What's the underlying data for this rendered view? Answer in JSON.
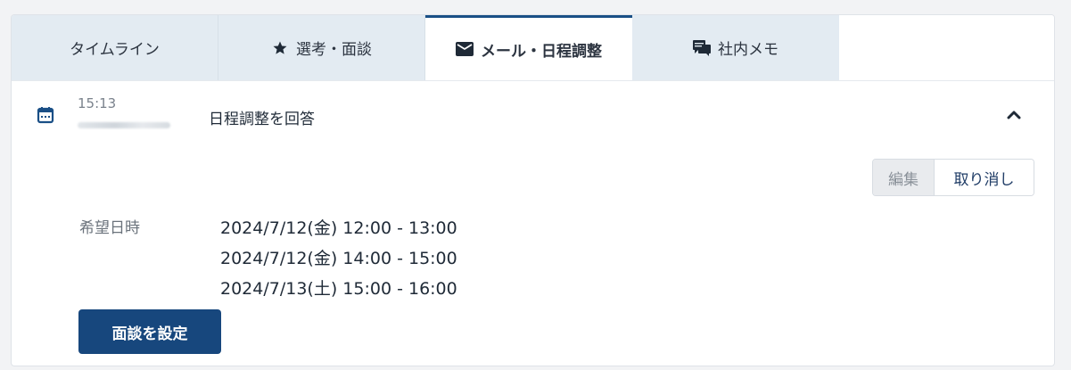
{
  "tabs": [
    {
      "label": "タイムライン",
      "icon": "",
      "active": false
    },
    {
      "label": "選考・面談",
      "icon": "star-icon",
      "active": false
    },
    {
      "label": "メール・日程調整",
      "icon": "mail-icon",
      "active": true
    },
    {
      "label": "社内メモ",
      "icon": "chat-icon",
      "active": false
    }
  ],
  "entry": {
    "time": "15:13",
    "title": "日程調整を回答"
  },
  "actions": {
    "edit_label": "編集",
    "cancel_label": "取り消し"
  },
  "details": {
    "preferred_label": "希望日時",
    "slots": [
      "2024/7/12(金) 12:00 - 13:00",
      "2024/7/12(金) 14:00 - 15:00",
      "2024/7/13(土) 15:00 - 16:00"
    ]
  },
  "primary_button": {
    "label": "面談を設定"
  },
  "colors": {
    "accent": "#17477d",
    "tab_bg": "#e3ebf2",
    "active_border": "#1a4f86"
  }
}
